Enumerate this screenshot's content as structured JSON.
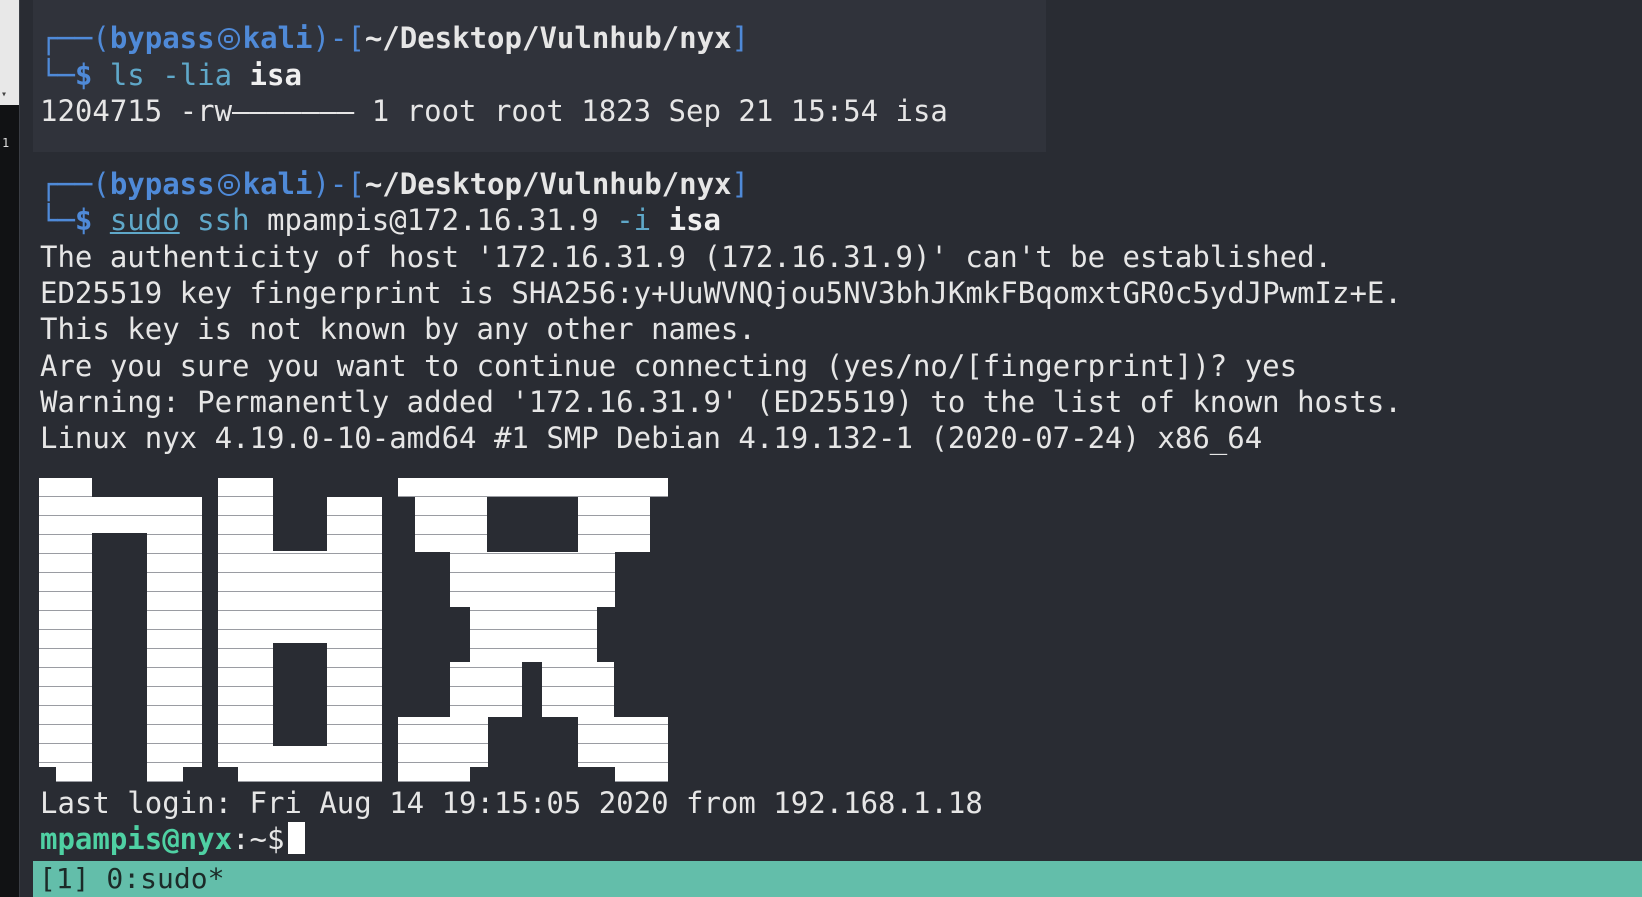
{
  "prompt": {
    "user": "bypass",
    "host": "kali",
    "path": "~/Desktop/Vulnhub/nyx"
  },
  "cmd1": {
    "program": "ls",
    "args": "-lia",
    "file": "isa"
  },
  "ls_output": "1204715 -rw——————— 1 root root 1823 Sep 21 15:54 isa",
  "cmd2": {
    "sudo": "sudo",
    "program": "ssh",
    "target": "mpampis@172.16.31.9",
    "flag": "-i",
    "file": "isa"
  },
  "ssh_output": [
    "The authenticity of host '172.16.31.9 (172.16.31.9)' can't be established.",
    "ED25519 key fingerprint is SHA256:y+UuWVNQjou5NV3bhJKmkFBqomxtGR0c5ydJPwmIz+E.",
    "This key is not known by any other names.",
    "Are you sure you want to continue connecting (yes/no/[fingerprint])? yes",
    "Warning: Permanently added '172.16.31.9' (ED25519) to the list of known hosts.",
    "Linux nyx 4.19.0-10-amd64 #1 SMP Debian 4.19.132-1 (2020-07-24) x86_64"
  ],
  "last_login": "Last login: Fri Aug 14 19:15:05 2020 from 192.168.1.18",
  "remote_prompt": {
    "userhost": "mpampis@nyx",
    "rest": ":~$"
  },
  "status_bar": "[1] 0:sudo*",
  "edge_number": "1",
  "colors": {
    "background": "#292c33",
    "prompt_blue": "#4f8ad8",
    "command_cyan": "#5fa8c9",
    "remote_green": "#4fd1a3",
    "status_bar": "#63beaa"
  }
}
